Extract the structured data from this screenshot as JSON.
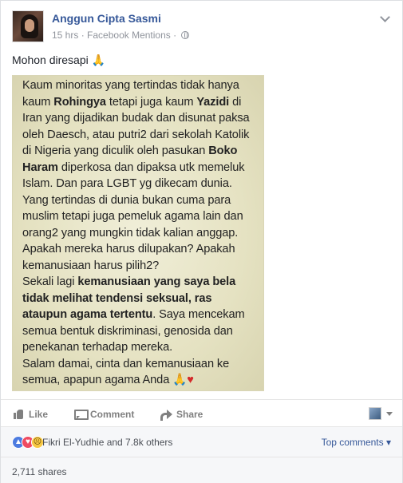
{
  "post": {
    "author": "Anggun Cipta Sasmi",
    "time": "15 hrs",
    "separator": "·",
    "source": "Facebook Mentions",
    "separator2": "·",
    "message": "Mohon diresapi",
    "message_emoji": "🙏",
    "icons": {
      "privacy": "globe-icon",
      "options": "chevron-down-icon"
    }
  },
  "image_text": {
    "p1_a": "Kaum minoritas yang tertindas tidak hanya kaum ",
    "p1_b": "Rohingya",
    "p1_c": " tetapi juga kaum ",
    "p1_d": "Yazidi",
    "p1_e": " di Iran yang dijadikan budak dan disunat paksa oleh Daesch, atau putri2 dari sekolah Katolik di Nigeria yang diculik oleh pasukan ",
    "p1_f": "Boko Haram",
    "p1_g": " diperkosa dan dipaksa utk memeluk Islam. Dan para LGBT yg dikecam dunia.",
    "p2": "Yang tertindas di dunia bukan cuma para muslim tetapi juga pemeluk agama lain dan orang2 yang mungkin tidak kalian anggap.",
    "p3": "Apakah mereka harus dilupakan? Apakah kemanusiaan harus pilih2?",
    "p4_a": "Sekali lagi ",
    "p4_b": "kemanusiaan yang saya bela tidak melihat tendensi seksual, ras ataupun agama tertentu",
    "p4_c": ". Saya mencekam semua bentuk diskriminasi, genosida dan penekanan terhadap mereka.",
    "p5": "Salam damai, cinta dan kemanusiaan ke semua, apapun agama Anda",
    "p5_emoji1": "🙏",
    "p5_emoji2": "♥"
  },
  "actions": {
    "like": "Like",
    "comment": "Comment",
    "share": "Share",
    "icons": {
      "like": "thumbs-up-icon",
      "comment": "comment-icon",
      "share": "share-arrow-icon"
    }
  },
  "reactions": {
    "summary": "Fikri El-Yudhie and 7.8k others",
    "top_comments": "Top comments",
    "top_comments_caret": "▾",
    "icons": [
      "like-reaction-icon",
      "love-reaction-icon",
      "sad-reaction-icon"
    ]
  },
  "shares": {
    "count": "2,711 shares"
  },
  "colors": {
    "link": "#365899",
    "meta": "#90949c",
    "photo_bg": "#e6e3c9"
  }
}
